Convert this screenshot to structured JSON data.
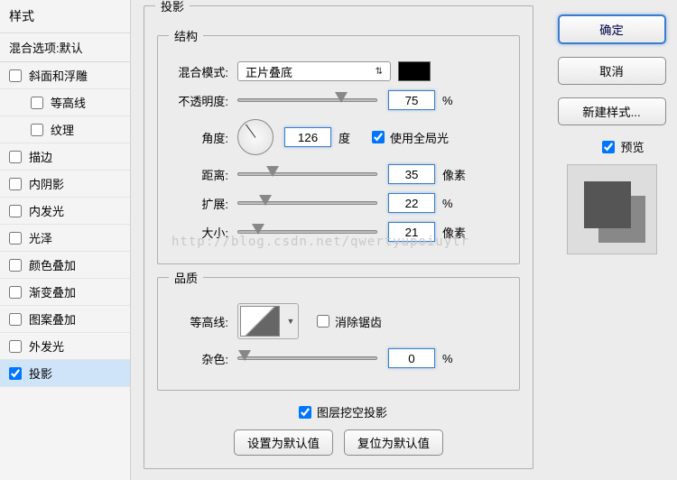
{
  "sidebar": {
    "header": "样式",
    "sub": "混合选项:默认",
    "items": [
      {
        "label": "斜面和浮雕",
        "checked": false,
        "indent": false
      },
      {
        "label": "等高线",
        "checked": false,
        "indent": true
      },
      {
        "label": "纹理",
        "checked": false,
        "indent": true
      },
      {
        "label": "描边",
        "checked": false,
        "indent": false
      },
      {
        "label": "内阴影",
        "checked": false,
        "indent": false
      },
      {
        "label": "内发光",
        "checked": false,
        "indent": false
      },
      {
        "label": "光泽",
        "checked": false,
        "indent": false
      },
      {
        "label": "颜色叠加",
        "checked": false,
        "indent": false
      },
      {
        "label": "渐变叠加",
        "checked": false,
        "indent": false
      },
      {
        "label": "图案叠加",
        "checked": false,
        "indent": false
      },
      {
        "label": "外发光",
        "checked": false,
        "indent": false
      },
      {
        "label": "投影",
        "checked": true,
        "indent": false,
        "selected": true
      }
    ]
  },
  "main": {
    "title": "投影",
    "structure": {
      "title": "结构",
      "blendMode": {
        "label": "混合模式:",
        "value": "正片叠底",
        "color": "#000000"
      },
      "opacity": {
        "label": "不透明度:",
        "value": "75",
        "unit": "%",
        "thumbPct": 70
      },
      "angle": {
        "label": "角度:",
        "value": "126",
        "unit": "度"
      },
      "globalLight": {
        "label": "使用全局光",
        "checked": true
      },
      "distance": {
        "label": "距离:",
        "value": "35",
        "unit": "像素",
        "thumbPct": 20
      },
      "spread": {
        "label": "扩展:",
        "value": "22",
        "unit": "%",
        "thumbPct": 15
      },
      "size": {
        "label": "大小:",
        "value": "21",
        "unit": "像素",
        "thumbPct": 10
      }
    },
    "quality": {
      "title": "品质",
      "contour": {
        "label": "等高线:"
      },
      "antiAlias": {
        "label": "消除锯齿",
        "checked": false
      },
      "noise": {
        "label": "杂色:",
        "value": "0",
        "unit": "%",
        "thumbPct": 0
      }
    },
    "knockout": {
      "label": "图层挖空投影",
      "checked": true
    },
    "buttons": {
      "default": "设置为默认值",
      "reset": "复位为默认值"
    }
  },
  "right": {
    "ok": "确定",
    "cancel": "取消",
    "newStyle": "新建样式...",
    "preview": {
      "label": "预览",
      "checked": true
    }
  },
  "watermark": "http://blog.csdn.net/qwertyupoiuytr"
}
